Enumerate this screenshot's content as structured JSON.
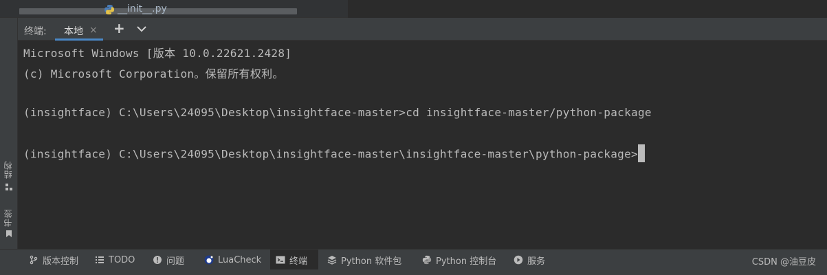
{
  "editor": {
    "file_name": "__init__.py"
  },
  "terminal": {
    "title": "终端:",
    "tab_label": "本地",
    "tab_close": "×",
    "plus": "+",
    "lines": [
      "Microsoft Windows [版本 10.0.22621.2428]",
      "(c) Microsoft Corporation。保留所有权利。",
      "",
      "(insightface) C:\\Users\\24095\\Desktop\\insightface-master>cd insightface-master/python-package",
      "",
      "(insightface) C:\\Users\\24095\\Desktop\\insightface-master\\insightface-master\\python-package>"
    ]
  },
  "left_bar": {
    "structure": "结构",
    "bookmarks": "书签"
  },
  "bottom_bar": {
    "items": [
      {
        "label": "版本控制",
        "icon": "branch-icon"
      },
      {
        "label": "TODO",
        "icon": "list-icon"
      },
      {
        "label": "问题",
        "icon": "info-icon"
      },
      {
        "label": "LuaCheck",
        "icon": "lua-icon"
      },
      {
        "label": "终端",
        "icon": "terminal-icon"
      },
      {
        "label": "Python 软件包",
        "icon": "layers-icon"
      },
      {
        "label": "Python 控制台",
        "icon": "python-icon"
      },
      {
        "label": "服务",
        "icon": "play-icon"
      }
    ],
    "watermark": "CSDN @油豆皮"
  },
  "colors": {
    "accent": "#4a88c7",
    "background": "#2b2b2b",
    "panel": "#3c3f41",
    "text": "#bbbbbb"
  }
}
